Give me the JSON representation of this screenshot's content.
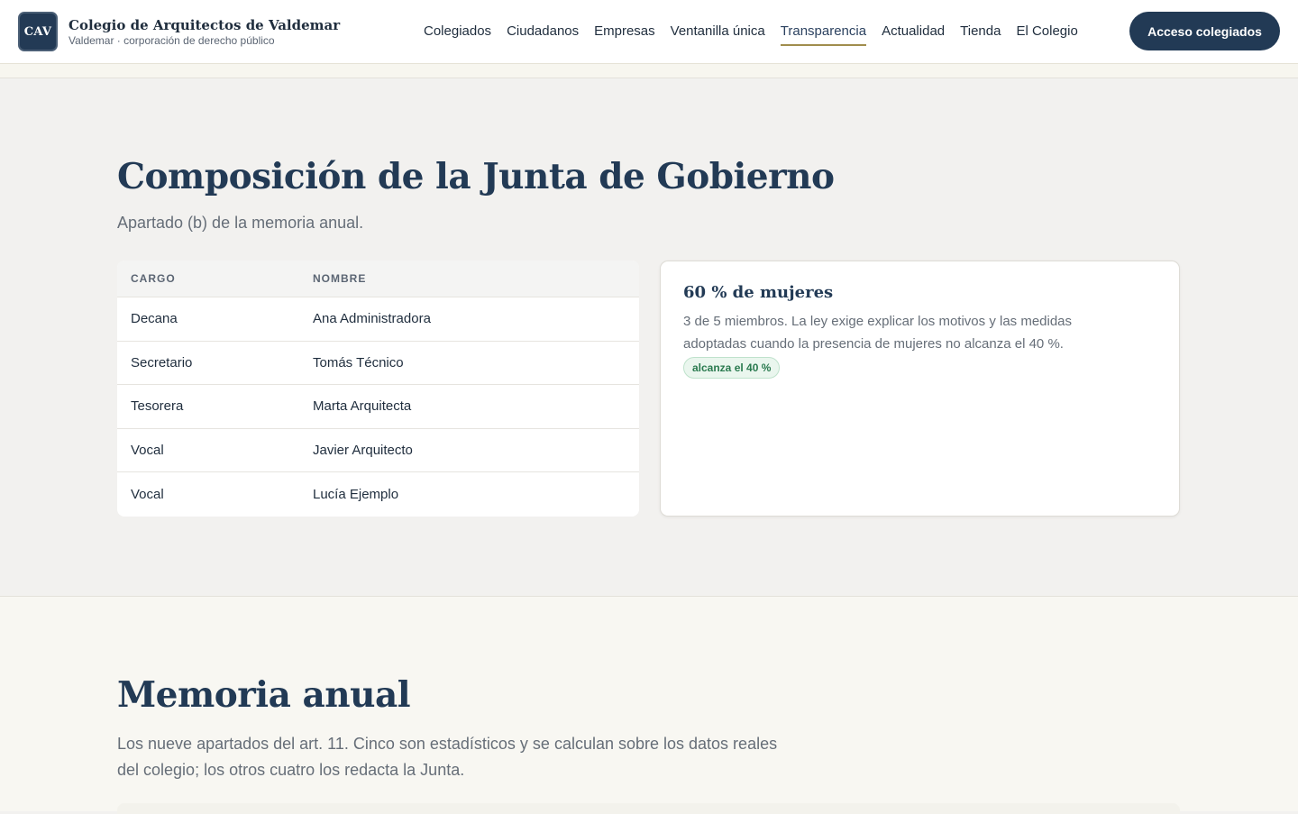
{
  "header": {
    "logo_text": "CAV",
    "brand_name": "Colegio de Arquitectos de Valdemar",
    "brand_sub": "Valdemar · corporación de derecho público",
    "nav": [
      {
        "label": "Colegiados"
      },
      {
        "label": "Ciudadanos"
      },
      {
        "label": "Empresas"
      },
      {
        "label": "Ventanilla única"
      },
      {
        "label": "Transparencia",
        "active": true
      },
      {
        "label": "Actualidad"
      },
      {
        "label": "Tienda"
      },
      {
        "label": "El Colegio"
      }
    ],
    "access_button": "Acceso colegiados"
  },
  "junta": {
    "title": "Composición de la Junta de Gobierno",
    "lead": "Apartado (b) de la memoria anual.",
    "columns": [
      "CARGO",
      "NOMBRE"
    ],
    "rows": [
      {
        "cargo": "Decana",
        "nombre": "Ana Administradora"
      },
      {
        "cargo": "Secretario",
        "nombre": "Tomás Técnico"
      },
      {
        "cargo": "Tesorera",
        "nombre": "Marta Arquitecta"
      },
      {
        "cargo": "Vocal",
        "nombre": "Javier Arquitecto"
      },
      {
        "cargo": "Vocal",
        "nombre": "Lucía Ejemplo"
      }
    ],
    "stat": {
      "title": "60 % de mujeres",
      "text": "3 de 5 miembros. La ley exige explicar los motivos y las medidas adoptadas cuando la presencia de mujeres no alcanza el 40 %.",
      "badge": "alcanza el 40 %"
    }
  },
  "memoria": {
    "title": "Memoria anual",
    "lead": "Los nueve apartados del art. 11. Cinco son estadísticos y se calculan sobre los datos reales del colegio; los otros cuatro los redacta la Junta."
  },
  "colors": {
    "primary": "#223a55",
    "accent_underline": "#a08d4d",
    "badge_green": "#2a7a4f"
  }
}
